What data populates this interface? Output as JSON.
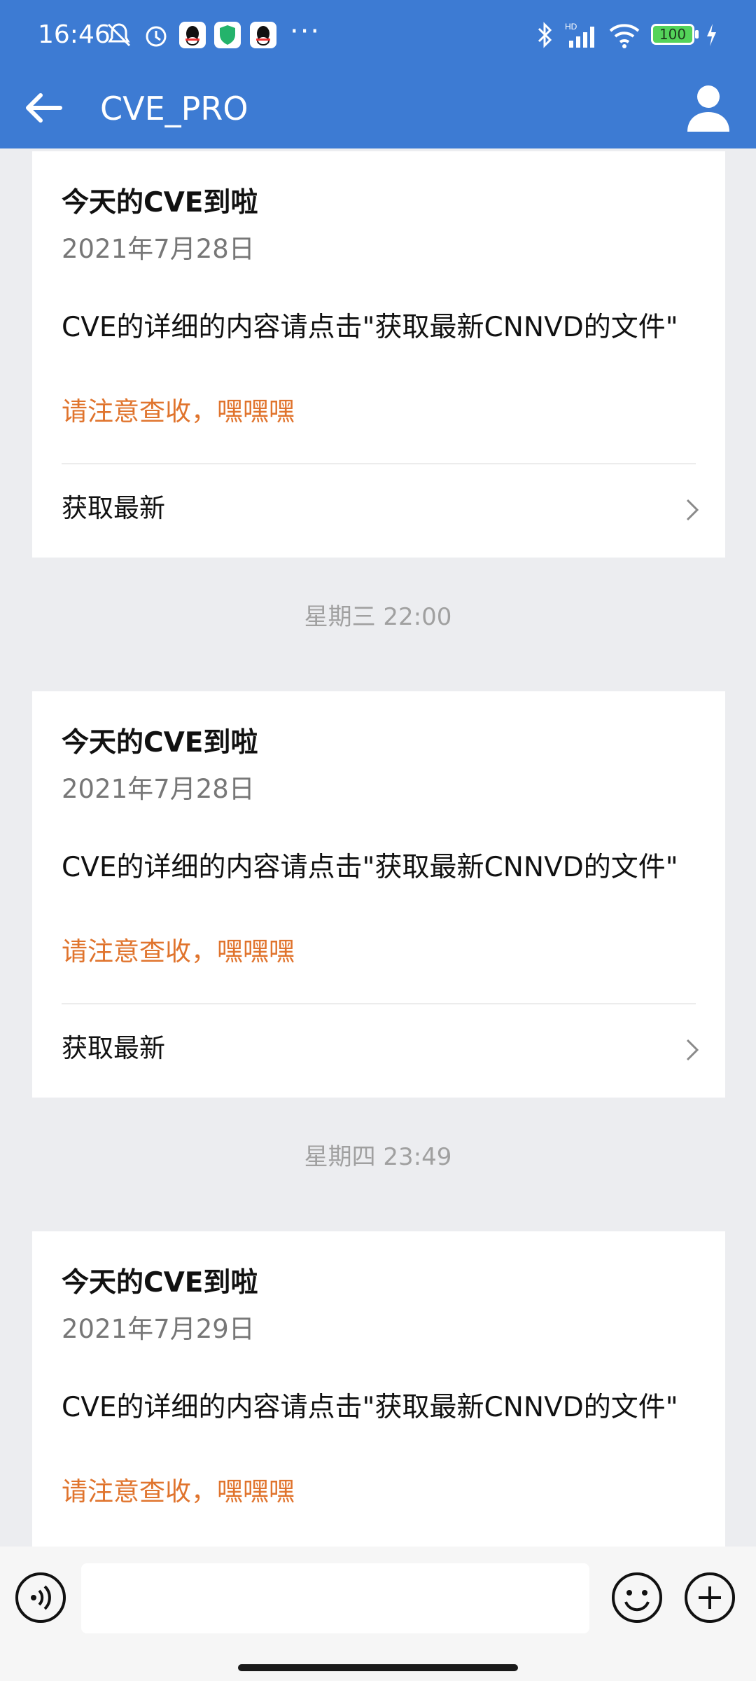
{
  "status_bar": {
    "time": "16:46",
    "icons": [
      "mute-bell-icon",
      "alarm-icon",
      "qq-icon",
      "security-shield-icon",
      "qq-icon",
      "more-dots-icon",
      "bluetooth-icon",
      "hd-signal-icon",
      "wifi-icon",
      "battery-icon",
      "charging-icon"
    ],
    "battery": "100",
    "signal_badge": "HD"
  },
  "header": {
    "title": "CVE_PRO",
    "back_icon": "back-arrow-icon",
    "profile_icon": "person-icon"
  },
  "messages": [
    {
      "title": "今天的CVE到啦",
      "date": "2021年7月28日",
      "body": " CVE的详细的内容请点击\"获取最新CNNVD的文件\"",
      "note": "请注意查收，嘿嘿嘿",
      "link": "获取最新"
    },
    {
      "title": "今天的CVE到啦",
      "date": "2021年7月28日",
      "body": " CVE的详细的内容请点击\"获取最新CNNVD的文件\"",
      "note": "请注意查收，嘿嘿嘿",
      "link": "获取最新"
    },
    {
      "title": "今天的CVE到啦",
      "date": "2021年7月29日",
      "body": " CVE的详细的内容请点击\"获取最新CNNVD的文件\"",
      "note": "请注意查收，嘿嘿嘿"
    }
  ],
  "timestamps": [
    "星期三 22:00",
    "星期四 23:49"
  ],
  "input_bar": {
    "value": "",
    "icons": [
      "voice-icon",
      "emoji-icon",
      "plus-icon"
    ]
  },
  "colors": {
    "header": "#3d7bd3",
    "background": "#ecedf0",
    "accent_orange": "#e0742d"
  }
}
